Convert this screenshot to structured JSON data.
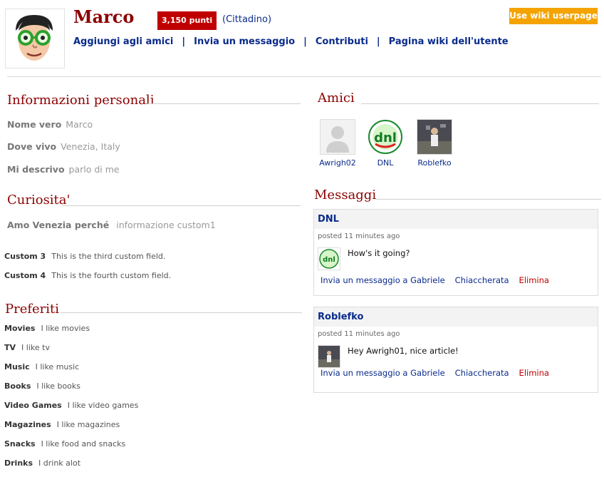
{
  "profile": {
    "username": "Marco",
    "points": "3,150 punti",
    "rank": "(Cittadino)",
    "wiki_button": "Use wiki userpage",
    "actions": [
      "Aggiungi agli amici",
      "Invia un messaggio",
      "Contributi",
      "Pagina wiki dell'utente"
    ]
  },
  "personal": {
    "title": "Informazioni personali",
    "fields": [
      {
        "label": "Nome vero",
        "value": "Marco"
      },
      {
        "label": "Dove vivo",
        "value": "Venezia, Italy"
      },
      {
        "label": "Mi descrivo",
        "value": "parlo di me"
      }
    ]
  },
  "curiosita": {
    "title": "Curiosita'",
    "fields": [
      {
        "label": "Amo Venezia perché",
        "value": "informazione custom1"
      }
    ],
    "custom": [
      {
        "label": "Custom 3",
        "value": "This is the third custom field."
      },
      {
        "label": "Custom 4",
        "value": "This is the fourth custom field."
      }
    ]
  },
  "preferiti": {
    "title": "Preferiti",
    "items": [
      {
        "label": "Movies",
        "value": "I like movies"
      },
      {
        "label": "TV",
        "value": "I like tv"
      },
      {
        "label": "Music",
        "value": "I like music"
      },
      {
        "label": "Books",
        "value": "I like books"
      },
      {
        "label": "Video Games",
        "value": "I like video games"
      },
      {
        "label": "Magazines",
        "value": "I like magazines"
      },
      {
        "label": "Snacks",
        "value": "I like food and snacks"
      },
      {
        "label": "Drinks",
        "value": "I drink alot"
      }
    ]
  },
  "amici": {
    "title": "Amici",
    "friends": [
      "Awrigh02",
      "DNL",
      "Roblefko"
    ]
  },
  "messaggi": {
    "title": "Messaggi",
    "items": [
      {
        "author": "DNL",
        "time": "posted 11 minutes ago",
        "text": "How's it going?"
      },
      {
        "author": "Roblefko",
        "time": "posted 11 minutes ago",
        "text": "Hey Awrigh01, nice article!"
      }
    ],
    "link_send": "Invia un messaggio a Gabriele",
    "link_chat": "Chiaccherata",
    "link_delete": "Elimina"
  },
  "colors": {
    "accent": "#8b0000",
    "link": "#0a2b8c",
    "points_bg": "#c00000",
    "wiki_btn": "#f4a300"
  }
}
